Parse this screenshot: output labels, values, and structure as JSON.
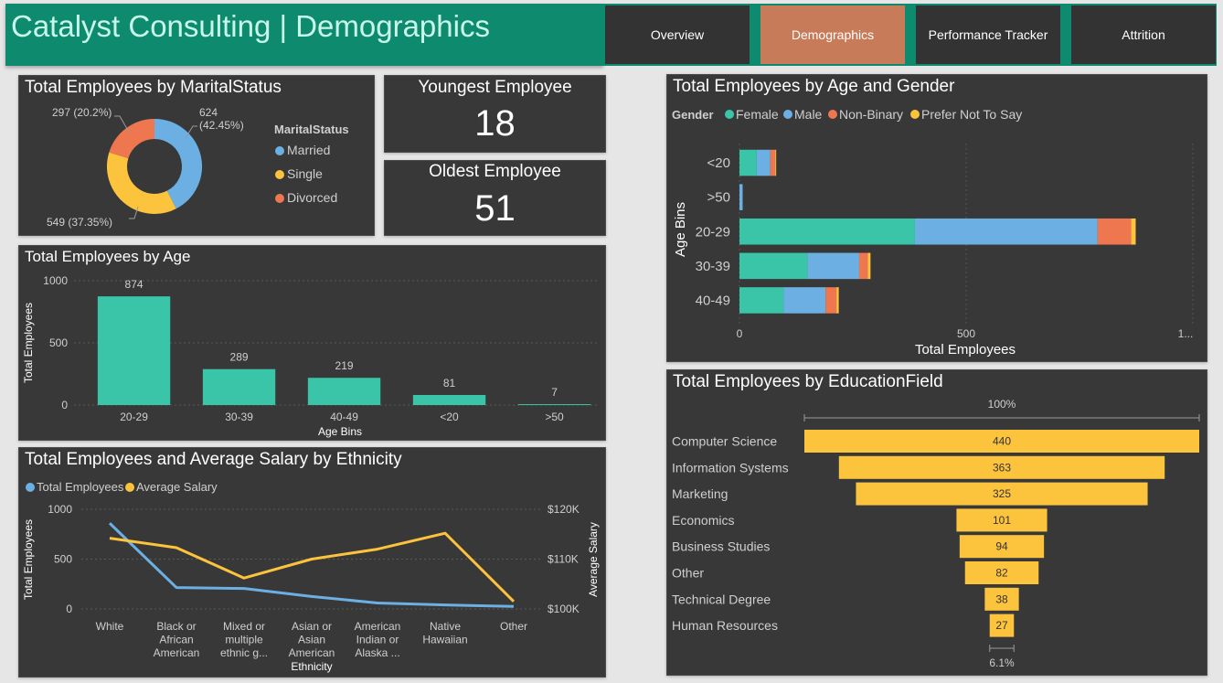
{
  "header": {
    "title": "Catalyst Consulting | Demographics"
  },
  "nav": {
    "tabs": [
      "Overview",
      "Demographics",
      "Performance Tracker",
      "Attrition"
    ],
    "active": "Demographics"
  },
  "colors": {
    "teal": "#3ac5a8",
    "blue": "#6cb0e3",
    "orange": "#ee7750",
    "yellow": "#fcc33d",
    "panel": "#383838",
    "header": "#0e8a6f",
    "active_tab": "#c87b59"
  },
  "kpi": {
    "youngest_label": "Youngest Employee",
    "youngest_value": "18",
    "oldest_label": "Oldest Employee",
    "oldest_value": "51"
  },
  "chart_data": [
    {
      "id": "marital",
      "type": "pie",
      "variant": "donut",
      "title": "Total Employees by MaritalStatus",
      "legend_title": "MaritalStatus",
      "legend_position": "right",
      "categories": [
        "Married",
        "Single",
        "Divorced"
      ],
      "values": [
        624,
        549,
        297
      ],
      "data_labels": [
        "624\n(42.45%)",
        "549 (37.35%)",
        "297 (20.2%)"
      ],
      "colors": [
        "#6cb0e3",
        "#fcc33d",
        "#ee7750"
      ]
    },
    {
      "id": "age",
      "type": "bar",
      "title": "Total Employees by Age",
      "xlabel": "Age Bins",
      "ylabel": "Total Employees",
      "categories": [
        "20-29",
        "30-39",
        "40-49",
        "<20",
        ">50"
      ],
      "values": [
        874,
        289,
        219,
        81,
        7
      ],
      "ylim": [
        0,
        1000
      ],
      "yticks": [
        0,
        500,
        1000
      ],
      "color": "#3ac5a8",
      "grid": true
    },
    {
      "id": "ethnicity",
      "type": "line",
      "title": "Total Employees and Average Salary by Ethnicity",
      "xlabel": "Ethnicity",
      "ylabel": "Total Employees",
      "y2label": "Average Salary",
      "categories": [
        "White",
        "Black or African American",
        "Mixed or multiple ethnic g...",
        "Asian or Asian American",
        "American Indian or Alaska ...",
        "Native Hawaiian",
        "Other"
      ],
      "category_lines": [
        [
          "White"
        ],
        [
          "Black or",
          "African",
          "American"
        ],
        [
          "Mixed or",
          "multiple",
          "ethnic g..."
        ],
        [
          "Asian or",
          "Asian",
          "American"
        ],
        [
          "American",
          "Indian or",
          "Alaska ..."
        ],
        [
          "Native",
          "Hawaiian"
        ],
        [
          "Other"
        ]
      ],
      "series": [
        {
          "name": "Total Employees",
          "axis": "left",
          "color": "#6cb0e3",
          "values": [
            860,
            215,
            205,
            125,
            60,
            40,
            25
          ]
        },
        {
          "name": "Average Salary",
          "axis": "right",
          "color": "#fcc33d",
          "values": [
            114200,
            112300,
            106200,
            110000,
            112000,
            115200,
            101500
          ]
        }
      ],
      "ylim": [
        0,
        1000
      ],
      "yticks": [
        0,
        500,
        1000
      ],
      "y2lim": [
        100000,
        120000
      ],
      "y2ticks": [
        100000,
        110000,
        120000
      ],
      "y2ticklabels": [
        "$100K",
        "$110K",
        "$120K"
      ],
      "legend_position": "top-left",
      "grid": true
    },
    {
      "id": "age_gender",
      "type": "bar",
      "orientation": "horizontal",
      "stacked": true,
      "title": "Total Employees by Age and Gender",
      "legend_title": "Gender",
      "legend_position": "top-left",
      "xlabel": "Total Employees",
      "ylabel": "Age Bins",
      "categories": [
        "<20",
        ">50",
        "20-29",
        "30-39",
        "40-49"
      ],
      "series": [
        {
          "name": "Female",
          "color": "#3ac5a8",
          "values": [
            38,
            0,
            387,
            150,
            97
          ]
        },
        {
          "name": "Male",
          "color": "#6cb0e3",
          "values": [
            30,
            7,
            403,
            114,
            93
          ]
        },
        {
          "name": "Non-Binary",
          "color": "#ee7750",
          "values": [
            11,
            0,
            74,
            19,
            24
          ]
        },
        {
          "name": "Prefer Not To Say",
          "color": "#fcc33d",
          "values": [
            2,
            0,
            10,
            6,
            5
          ]
        }
      ],
      "xlim": [
        0,
        1000
      ],
      "xticks": [
        0,
        500
      ],
      "xticklabels": [
        "0",
        "500",
        "1..."
      ],
      "grid": true
    },
    {
      "id": "education",
      "type": "bar",
      "variant": "funnel",
      "title": "Total Employees by EducationField",
      "categories": [
        "Computer Science",
        "Information Systems",
        "Marketing",
        "Economics",
        "Business Studies",
        "Other",
        "Technical Degree",
        "Human Resources"
      ],
      "values": [
        440,
        363,
        325,
        101,
        94,
        82,
        38,
        27
      ],
      "top_percent_label": "100%",
      "bottom_percent_label": "6.1%",
      "color": "#fcc33d"
    }
  ]
}
